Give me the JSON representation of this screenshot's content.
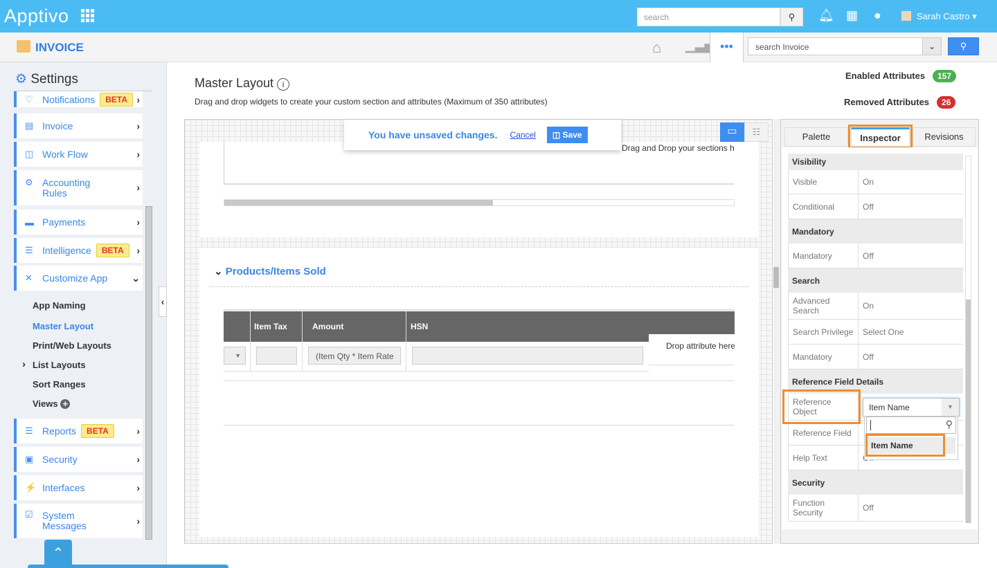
{
  "topbar": {
    "logo": "Apptivo",
    "search_placeholder": "search",
    "user": "Sarah Castro"
  },
  "app": {
    "title": "INVOICE",
    "search_placeholder": "search Invoice"
  },
  "sidebar": {
    "title": "Settings",
    "items": [
      {
        "label": "Notifications",
        "beta": "BETA"
      },
      {
        "label": "Invoice"
      },
      {
        "label": "Work Flow"
      },
      {
        "label": "Accounting Rules"
      },
      {
        "label": "Payments"
      },
      {
        "label": "Intelligence",
        "beta": "BETA"
      },
      {
        "label": "Customize App"
      },
      {
        "label": "Reports",
        "beta": "BETA"
      },
      {
        "label": "Security"
      },
      {
        "label": "Interfaces"
      },
      {
        "label": "System Messages"
      }
    ],
    "subitems": [
      "App Naming",
      "Master Layout",
      "Print/Web Layouts",
      "List Layouts",
      "Sort Ranges",
      "Views"
    ]
  },
  "main": {
    "title": "Master Layout",
    "description": "Drag and drop widgets to create your custom section and attributes (Maximum of 350 attributes)",
    "enabled_label": "Enabled Attributes",
    "enabled_count": "157",
    "removed_label": "Removed Attributes",
    "removed_count": "26",
    "unsaved": "You have unsaved changes.",
    "cancel": "Cancel",
    "save": "Save",
    "drag_sections": "Drag and Drop your sections h",
    "section_title": "Products/Items Sold",
    "columns": [
      "Item Tax",
      "Amount",
      "HSN"
    ],
    "amount_value": "(Item Qty * Item Rate",
    "drop_attr": "Drop attribute here"
  },
  "panel": {
    "tabs": [
      "Palette",
      "Inspector",
      "Revisions"
    ],
    "sections": [
      {
        "header": "Visibility",
        "rows": [
          [
            "Visible",
            "On"
          ],
          [
            "Conditional",
            "Off"
          ]
        ]
      },
      {
        "header": "Mandatory",
        "rows": [
          [
            "Mandatory",
            "Off"
          ]
        ]
      },
      {
        "header": "Search",
        "rows": [
          [
            "Advanced Search",
            "On"
          ],
          [
            "Search Privilege",
            "Select One"
          ],
          [
            "Mandatory",
            "Off"
          ]
        ]
      },
      {
        "header": "Reference Field Details",
        "rows": [
          [
            "Reference Object",
            "Item Name"
          ],
          [
            "Reference Field",
            ""
          ],
          [
            "Help Text",
            "Off"
          ]
        ]
      },
      {
        "header": "Security",
        "rows": [
          [
            "Function Security",
            "Off"
          ]
        ]
      }
    ],
    "dropdown_option": "Item Name"
  },
  "colors": {
    "topbar": "#4bbcf3",
    "accent": "#3a86e6",
    "highlight": "#eb8f2f"
  }
}
